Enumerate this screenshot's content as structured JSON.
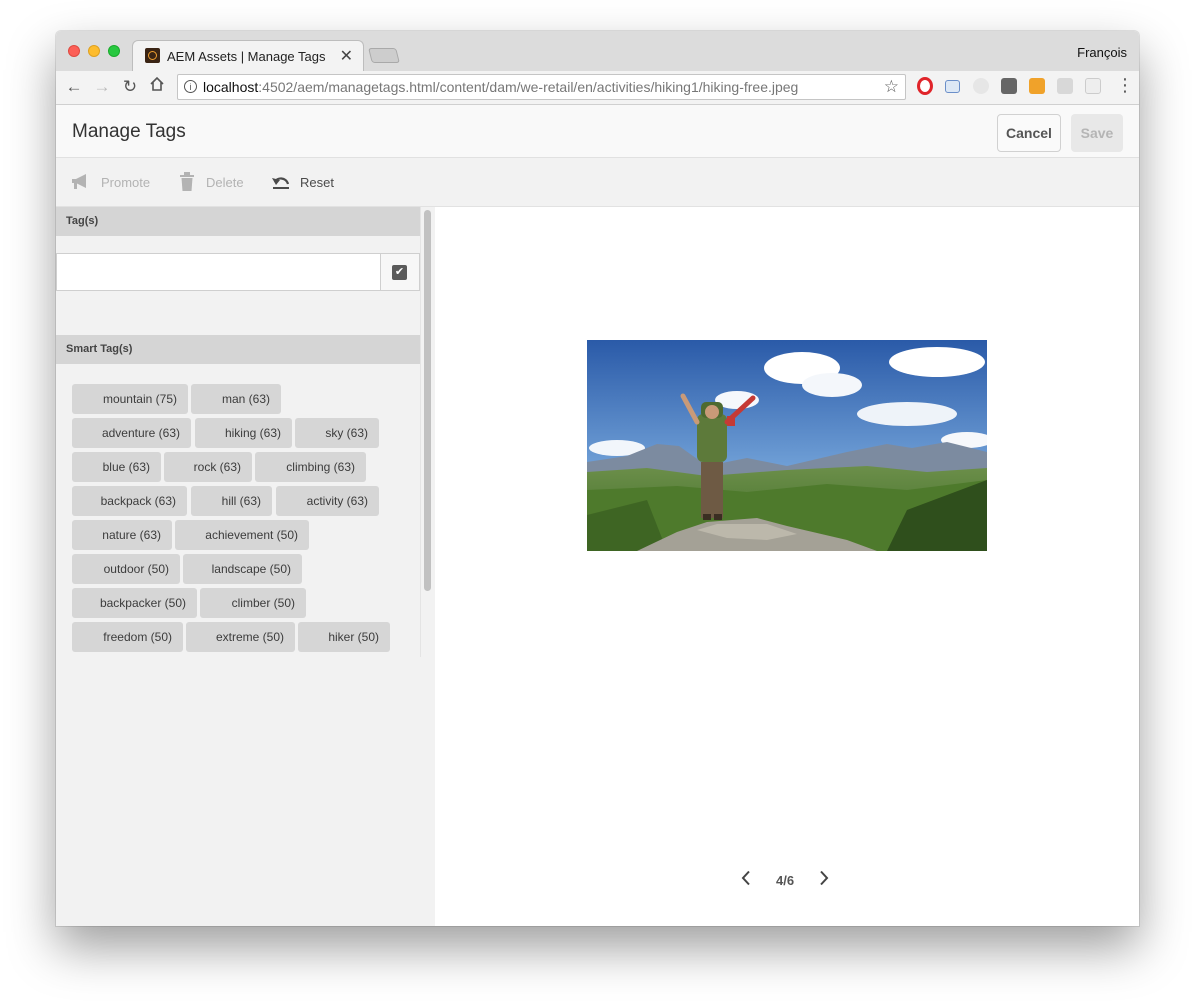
{
  "browser": {
    "tab_title": "AEM Assets | Manage Tags",
    "tab_close": "✕",
    "profile_name": "François",
    "url_host": "localhost",
    "url_rest": ":4502/aem/managetags.html/content/dam/we-retail/en/activities/hiking1/hiking-free.jpeg"
  },
  "header": {
    "title": "Manage Tags",
    "cancel_label": "Cancel",
    "save_label": "Save"
  },
  "actions": {
    "promote_label": "Promote",
    "delete_label": "Delete",
    "reset_label": "Reset"
  },
  "tags_section": {
    "header": "Tag(s)",
    "input_value": ""
  },
  "smart_tags_section": {
    "header": "Smart Tag(s)",
    "rows": [
      [
        "mountain (75)",
        "man (63)"
      ],
      [
        "adventure (63)",
        "hiking (63)",
        "sky (63)"
      ],
      [
        "blue (63)",
        "rock (63)",
        "climbing (63)"
      ],
      [
        "backpack (63)",
        "hill (63)",
        "activity (63)"
      ],
      [
        "nature (63)",
        "achievement (50)"
      ],
      [
        "outdoor (50)",
        "landscape (50)"
      ],
      [
        "backpacker (50)",
        "climber (50)"
      ],
      [
        "freedom (50)",
        "extreme (50)",
        "hiker (50)"
      ]
    ]
  },
  "preview": {
    "pager_text": "4/6"
  },
  "colors": {
    "panel_bg": "#f2f2f2",
    "chip_bg": "#d6d6d6",
    "section_header_bg": "#d5d5d5"
  },
  "icons": {
    "promote": "megaphone-icon",
    "delete": "trash-icon",
    "reset": "undo-icon",
    "submit": "checkbox-check-icon",
    "prev": "chevron-left-icon",
    "next": "chevron-right-icon"
  }
}
